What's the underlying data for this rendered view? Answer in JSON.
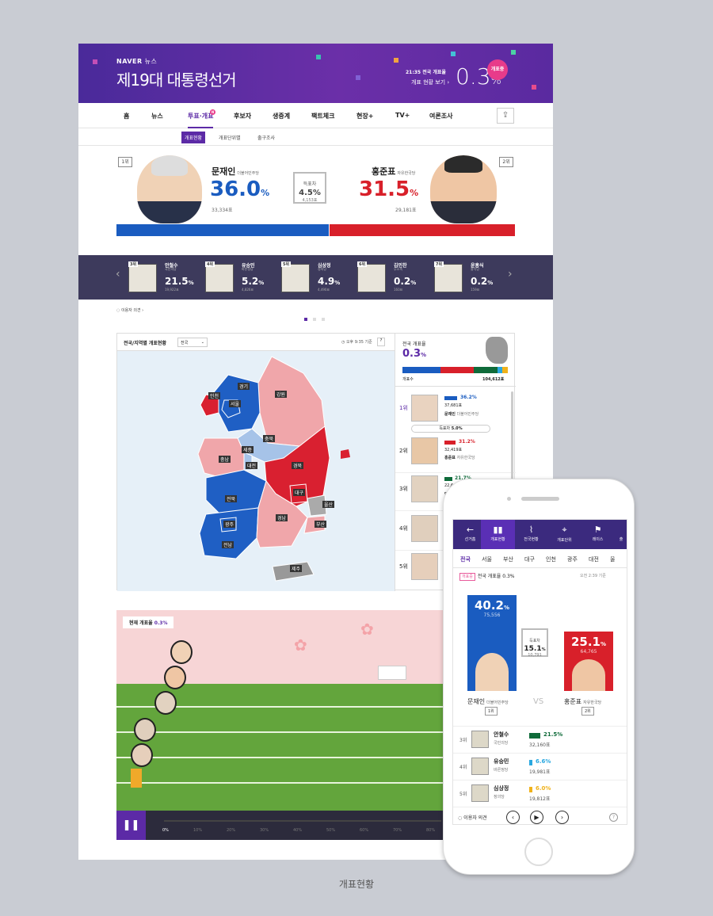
{
  "banner": {
    "brand": "NAVER",
    "brand_sub": "뉴스",
    "title": "제19대 대통령선거",
    "count_label": "21:35 전국 개표율",
    "view_label": "개표 현황 보기 ›",
    "pct": "0.3",
    "pct_unit": "%",
    "badge": "개표중"
  },
  "nav": {
    "items": [
      "홈",
      "뉴스",
      "투표·개표",
      "후보자",
      "생중계",
      "팩트체크",
      "현장+",
      "TV+",
      "여론조사"
    ],
    "active_badge": "N"
  },
  "subnav": {
    "items": [
      "개표현황",
      "개표단위별",
      "출구조사"
    ]
  },
  "top": {
    "left": {
      "rank": "1위",
      "name": "문재인",
      "party": "더불어민주당",
      "pct": "36.0",
      "unit": "%",
      "votes": "33,334표"
    },
    "right": {
      "rank": "2위",
      "name": "홍준표",
      "party": "자유한국당",
      "pct": "31.5",
      "unit": "%",
      "votes": "29,181표"
    },
    "diff": {
      "label": "득표차",
      "pct": "4.5%",
      "votes": "4,153표"
    },
    "bar": {
      "left_share": 0.533,
      "right_share": 0.467
    }
  },
  "others": [
    {
      "rank": "3위",
      "name": "안철수",
      "party": "국민의당",
      "pct": "21.5",
      "votes": "19,922표"
    },
    {
      "rank": "4위",
      "name": "유승민",
      "party": "바른정당",
      "pct": "5.2",
      "votes": "4,826표"
    },
    {
      "rank": "5위",
      "name": "심상정",
      "party": "정의당",
      "pct": "4.9",
      "votes": "4,490표"
    },
    {
      "rank": "6위",
      "name": "김민찬",
      "party": "무소속",
      "pct": "0.2",
      "votes": "160표"
    },
    {
      "rank": "7위",
      "name": "윤홍식",
      "party": "홍익당",
      "pct": "0.2",
      "votes": "159표"
    }
  ],
  "opinion": "이용자 의견 ›",
  "map": {
    "title": "전국/지역별 개표현황",
    "select": "전국",
    "time": "오후 9:35 기준",
    "help": "?",
    "regions": [
      "강원",
      "경기",
      "인천",
      "서울",
      "충북",
      "세종",
      "충남",
      "대전",
      "전북",
      "경북",
      "대구",
      "울산",
      "전남",
      "광주",
      "부산",
      "경남",
      "제주"
    ]
  },
  "national": {
    "label": "전국 개표율",
    "pct": "0.3",
    "unit": "%",
    "votes_label": "개표수",
    "votes": "104,612표"
  },
  "ranklist": [
    {
      "rank": "1위",
      "pct": "36.2%",
      "votes": "37,681표",
      "name": "문재인",
      "party": "더불어민주당"
    },
    {
      "diff_label": "득표차",
      "diff": "5.0%"
    },
    {
      "rank": "2위",
      "pct": "31.2%",
      "votes": "32,419표",
      "name": "홍준표",
      "party": "자유한국당"
    },
    {
      "rank": "3위",
      "pct": "21.7%",
      "votes": "22,6",
      "name": "안",
      "party": ""
    },
    {
      "rank": "4위"
    },
    {
      "rank": "5위"
    }
  ],
  "race": {
    "label": "현재 개표율",
    "pct": "0.3",
    "unit": "%",
    "ticks": [
      "0%",
      "10%",
      "20%",
      "30%",
      "40%",
      "50%",
      "60%",
      "70%",
      "80%"
    ],
    "pause": "❚❚"
  },
  "mobile": {
    "tabs": [
      "선거홈",
      "개표현황",
      "전국현황",
      "개표단위",
      "레이스",
      "출"
    ],
    "regions": [
      "전국",
      "서울",
      "부산",
      "대구",
      "인천",
      "광주",
      "대전",
      "울"
    ],
    "status_badge": "개표중",
    "status": "전국 개표율 0.3%",
    "time": "오전 2:39 기준",
    "left": {
      "pct": "40.2",
      "unit": "%",
      "votes": "75,556",
      "name": "문재인",
      "party": "더불어민주당",
      "rank": "1위"
    },
    "right": {
      "pct": "25.1",
      "unit": "%",
      "votes": "64,765",
      "name": "홍준표",
      "party": "자유한국당",
      "rank": "2위"
    },
    "diff": {
      "label": "득표차",
      "pct": "15.1",
      "unit": "%",
      "votes": "10,791"
    },
    "vs": "VS",
    "rows": [
      {
        "rank": "3위",
        "name": "안철수",
        "party": "국민의당",
        "pct": "21.5%",
        "votes": "32,160표",
        "color": "#0f6b3a"
      },
      {
        "rank": "4위",
        "name": "유승민",
        "party": "바른정당",
        "pct": "6.6%",
        "votes": "19,981표",
        "color": "#2aa8e0"
      },
      {
        "rank": "5위",
        "name": "심상정",
        "party": "정의당",
        "pct": "6.0%",
        "votes": "19,812표",
        "color": "#f0b21b"
      }
    ],
    "opinion": "이용자 의견"
  },
  "caption": "개표현황"
}
